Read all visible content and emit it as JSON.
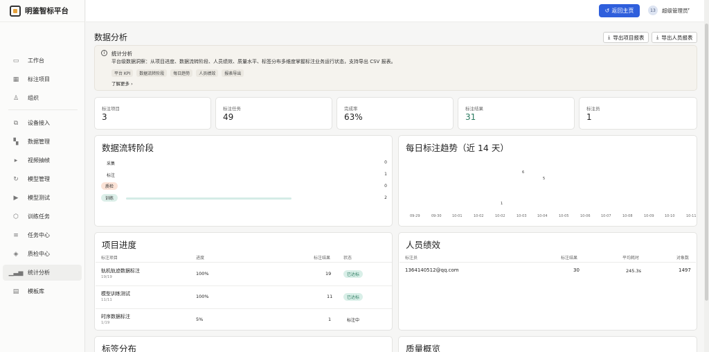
{
  "app": {
    "name": "明鉴智标平台"
  },
  "sidebar": {
    "items": [
      {
        "label": "工作台",
        "icon": "monitor-icon"
      },
      {
        "label": "标注项目",
        "icon": "grid-icon"
      },
      {
        "label": "组织",
        "icon": "org-icon"
      },
      {
        "label": "设备接入",
        "icon": "device-icon"
      },
      {
        "label": "数据管理",
        "icon": "database-icon"
      },
      {
        "label": "视频抽帧",
        "icon": "play-icon"
      },
      {
        "label": "模型管理",
        "icon": "model-icon"
      },
      {
        "label": "模型测试",
        "icon": "play-icon"
      },
      {
        "label": "训练任务",
        "icon": "cube-icon"
      },
      {
        "label": "任务中心",
        "icon": "list-icon"
      },
      {
        "label": "质检中心",
        "icon": "shield-icon"
      },
      {
        "label": "统计分析",
        "icon": "chart-icon",
        "active": true
      },
      {
        "label": "模板库",
        "icon": "book-icon"
      }
    ]
  },
  "topbar": {
    "home_label": "返回主页",
    "avatar_text": "13",
    "username": "超级管理员"
  },
  "page": {
    "title": "数据分析",
    "export_project": "导出项目报表",
    "export_people": "导出人员报表"
  },
  "info": {
    "title": "统计分析",
    "desc": "平台级数据洞察：从项目进度、数据流转阶段、人员绩效、质量水平、标签分布多维度掌握标注业务运行状态，支持导出 CSV 报表。",
    "chips": [
      "平台 KPI",
      "数据流转阶段",
      "每日趋势",
      "人员绩效",
      "报表导出"
    ],
    "learn_more": "了解更多 ›"
  },
  "stats": [
    {
      "label": "标注项目",
      "value": "3"
    },
    {
      "label": "标注任务",
      "value": "49"
    },
    {
      "label": "完成率",
      "value": "63%"
    },
    {
      "label": "标注结果",
      "value": "31"
    },
    {
      "label": "标注员",
      "value": "1"
    }
  ],
  "flow": {
    "title": "数据流转阶段",
    "stages": [
      {
        "label": "采集",
        "value": "0",
        "fraction": 0,
        "color": "#cfd7e6",
        "bg": "transparent"
      },
      {
        "label": "标注",
        "value": "1",
        "fraction": 0,
        "color": "#cfd7e6",
        "bg": "transparent"
      },
      {
        "label": "质检",
        "value": "0",
        "fraction": 0,
        "color": "#f6c9b4",
        "bg": "#fbe3d7"
      },
      {
        "label": "训练",
        "value": "2",
        "fraction": 0.63,
        "color": "#d4ece6",
        "bg": "#dcefe9"
      }
    ]
  },
  "trend": {
    "title": "每日标注趋势（近 14 天）",
    "dates": [
      "09-29",
      "09-30",
      "10-01",
      "10-02",
      "10-02",
      "10-03",
      "10-04",
      "10-05",
      "10-06",
      "10-07",
      "10-08",
      "10-09",
      "10-10",
      "10-11"
    ],
    "points": [
      {
        "index": 4,
        "label": "1"
      },
      {
        "index": 5,
        "label": "6"
      },
      {
        "index": 6,
        "label": "5"
      }
    ]
  },
  "projects": {
    "title": "项目进度",
    "headers": [
      "标注项目",
      "进度",
      "标注结果",
      "状态"
    ],
    "rows": [
      {
        "name": "轨机轨迹数据标注",
        "sub": "19/19",
        "progress": "100%",
        "results": "19",
        "status": "已达标",
        "badge": true
      },
      {
        "name": "模型训练测试",
        "sub": "11/11",
        "progress": "100%",
        "results": "11",
        "status": "已达标",
        "badge": true
      },
      {
        "name": "时序数据标注",
        "sub": "1/19",
        "progress": "5%",
        "results": "1",
        "status": "标注中",
        "badge": false
      }
    ]
  },
  "people": {
    "title": "人员绩效",
    "headers": [
      "标注员",
      "标注结果",
      "平均耗时",
      "对象数"
    ],
    "rows": [
      {
        "name": "1364140512@qq.com",
        "results": "30",
        "avg": "245.3s",
        "objects": "1497"
      }
    ]
  },
  "bottom": {
    "labels_title": "标签分布",
    "quality_title": "质量概览"
  },
  "colors": {
    "primary": "#2f5fdc",
    "success": "#d9efe8",
    "success_text": "#2a7a5f"
  }
}
